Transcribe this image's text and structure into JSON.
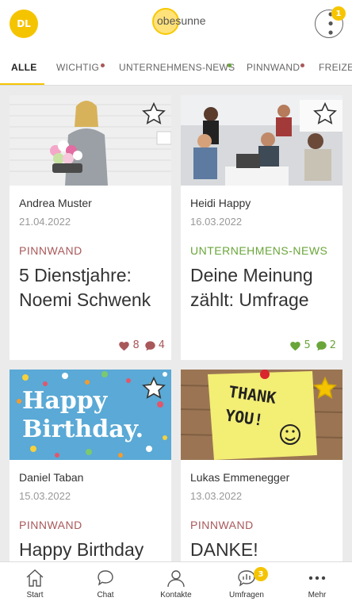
{
  "header": {
    "avatar_initials": "DL",
    "logo_text": "obesunne",
    "notification_count": "1"
  },
  "tabs": [
    {
      "label": "ALLE",
      "active": true
    },
    {
      "label": "WICHTIG",
      "dot_color": "#a9585a"
    },
    {
      "label": "UNTERNEHMENS-NEWS",
      "dot_color": "#6aa53a"
    },
    {
      "label": "PINNWAND",
      "dot_color": "#a9585a"
    },
    {
      "label": "FREIZEIT"
    }
  ],
  "cards": [
    {
      "author": "Andrea Muster",
      "date": "21.04.2022",
      "category": "PINNWAND",
      "title": "5 Dienstjahre: Noemi Schwenk",
      "likes": "8",
      "comments": "4",
      "starred": false
    },
    {
      "author": "Heidi Happy",
      "date": "16.03.2022",
      "category": "UNTERNEHMENS-NEWS",
      "title": "Deine Meinung zählt: Umfrage",
      "likes": "5",
      "comments": "2",
      "starred": false
    },
    {
      "author": "Daniel Taban",
      "date": "15.03.2022",
      "category": "PINNWAND",
      "title": "Happy Birthday",
      "image_text": "Happy Birthday.",
      "starred": false
    },
    {
      "author": "Lukas Emmenegger",
      "date": "13.03.2022",
      "category": "PINNWAND",
      "title": "DANKE!",
      "image_text": "THANK YOU!",
      "starred": true
    }
  ],
  "bottom_nav": [
    {
      "label": "Start",
      "icon": "home-icon"
    },
    {
      "label": "Chat",
      "icon": "chat-icon"
    },
    {
      "label": "Kontakte",
      "icon": "person-icon"
    },
    {
      "label": "Umfragen",
      "icon": "poll-icon",
      "badge": "3"
    },
    {
      "label": "Mehr",
      "icon": "more-icon"
    }
  ],
  "colors": {
    "accent": "#f5c400",
    "pinnwand": "#a9585a",
    "news": "#6aa53a",
    "background": "#ebebeb"
  }
}
